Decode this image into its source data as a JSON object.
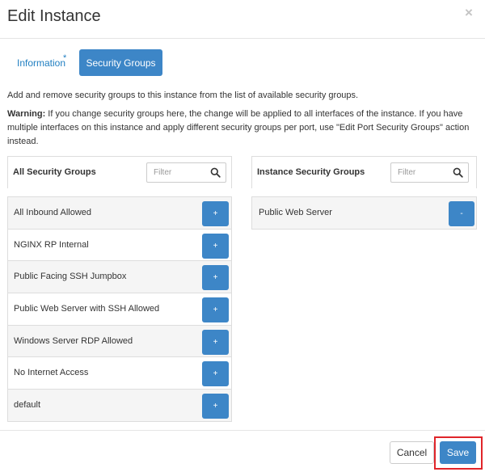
{
  "dialog": {
    "title": "Edit Instance",
    "close_symbol": "×"
  },
  "tabs": [
    {
      "label": "Information",
      "required_marker": "*",
      "active": false
    },
    {
      "label": "Security Groups",
      "active": true
    }
  ],
  "description": "Add and remove security groups to this instance from the list of available security groups.",
  "warning": {
    "label": "Warning:",
    "text": " If you change security groups here, the change will be applied to all interfaces of the instance. If you have multiple interfaces on this instance and apply different security groups per port, use \"Edit Port Security Groups\" action instead."
  },
  "available": {
    "title": "All Security Groups",
    "filter_placeholder": "Filter",
    "add_label": "+",
    "items": [
      "All Inbound Allowed",
      "NGINX RP Internal",
      "Public Facing SSH Jumpbox",
      "Public Web Server with SSH Allowed",
      "Windows Server RDP Allowed",
      "No Internet Access",
      "default"
    ]
  },
  "allocated": {
    "title": "Instance Security Groups",
    "filter_placeholder": "Filter",
    "remove_label": "-",
    "items": [
      "Public Web Server"
    ]
  },
  "footer": {
    "cancel_label": "Cancel",
    "save_label": "Save"
  },
  "colors": {
    "accent": "#3d86c7",
    "link": "#1f7ec1",
    "highlight": "#e0252a"
  },
  "icons": {
    "filter": "search-icon",
    "close": "close-icon"
  }
}
